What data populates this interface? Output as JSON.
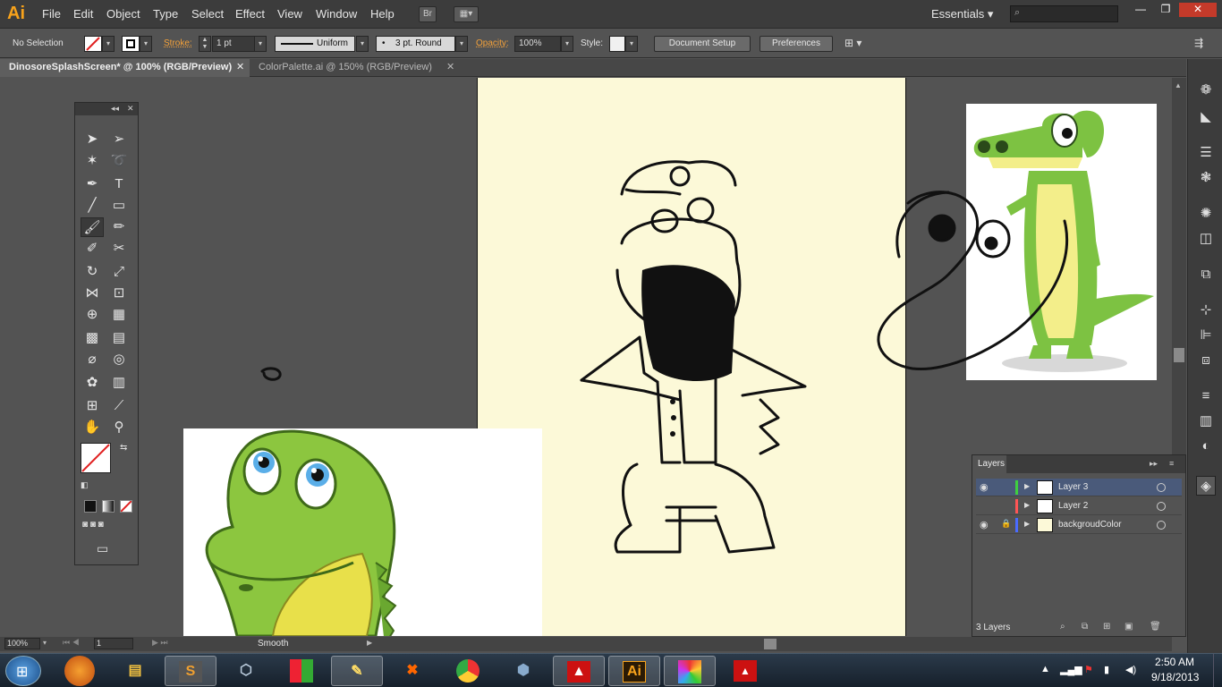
{
  "app": {
    "logo": "Ai"
  },
  "menu": [
    "File",
    "Edit",
    "Object",
    "Type",
    "Select",
    "Effect",
    "View",
    "Window",
    "Help"
  ],
  "menubar": {
    "bridge_btn": "Br",
    "workspace": "Essentials"
  },
  "control_bar": {
    "selection": "No Selection",
    "stroke_label": "Stroke:",
    "stroke_weight": "1 pt",
    "profile": "Uniform",
    "brush": "3 pt. Round",
    "opacity_label": "Opacity:",
    "opacity": "100%",
    "style_label": "Style:",
    "document_setup": "Document Setup",
    "preferences": "Preferences"
  },
  "tabs": [
    {
      "label": "DinosoreSplashScreen* @ 100% (RGB/Preview)"
    },
    {
      "label": "ColorPalette.ai @ 150% (RGB/Preview)"
    }
  ],
  "tools": [
    [
      "selection-icon",
      "direct-selection-icon"
    ],
    [
      "magic-wand-icon",
      "lasso-icon"
    ],
    [
      "pen-icon",
      "type-icon"
    ],
    [
      "line-segment-icon",
      "rectangle-icon"
    ],
    [
      "paintbrush-icon",
      "pencil-icon"
    ],
    [
      "blob-brush-icon",
      "scissors-icon"
    ],
    [
      "rotate-icon",
      "scale-icon"
    ],
    [
      "width-icon",
      "free-transform-icon"
    ],
    [
      "shape-builder-icon",
      "perspective-grid-icon"
    ],
    [
      "mesh-icon",
      "gradient-icon"
    ],
    [
      "eyedropper-icon",
      "blend-icon"
    ],
    [
      "symbol-sprayer-icon",
      "column-graph-icon"
    ],
    [
      "artboard-icon",
      "slice-icon"
    ],
    [
      "hand-icon",
      "zoom-icon"
    ]
  ],
  "colors": {
    "artboard": "#fcf9d8",
    "layer3": "#3fcf3f",
    "layer2": "#ff5555",
    "background_layer": "#4a6bff",
    "accent": "#f7a21b"
  },
  "layers": {
    "title": "Layers",
    "rows": [
      {
        "name": "Layer 3",
        "visible": true,
        "locked": false,
        "selected": true
      },
      {
        "name": "Layer 2",
        "visible": false,
        "locked": false,
        "selected": false
      },
      {
        "name": "backgroudColor",
        "visible": true,
        "locked": true,
        "selected": false
      }
    ],
    "count": "3 Layers"
  },
  "status": {
    "zoom": "100%",
    "artboard": "1",
    "tool": "Smooth"
  },
  "taskbar": {
    "apps": [
      "firefox-icon",
      "explorer-icon",
      "sublime-icon",
      "box-icon",
      "office-icon",
      "notepad-icon",
      "xampp-icon",
      "chrome-icon",
      "virtualbox-icon",
      "acrobat-icon",
      "illustrator-icon",
      "palette-icon",
      "adobe-cc-icon"
    ],
    "illustrator_label": "Ai",
    "sublime_label": "S",
    "time": "2:50 AM",
    "date": "9/18/2013"
  }
}
